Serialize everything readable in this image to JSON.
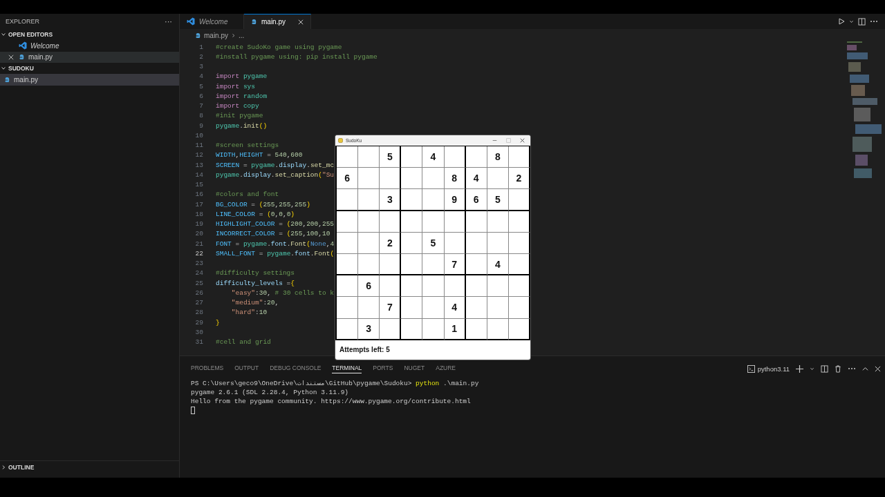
{
  "sidebar": {
    "title": "EXPLORER",
    "more": "···",
    "sections": [
      {
        "title": "OPEN EDITORS",
        "expanded": true,
        "items": [
          {
            "label": "Welcome",
            "kind": "welcome",
            "preview": true,
            "selected": false
          },
          {
            "label": "main.py",
            "kind": "python",
            "preview": false,
            "selected": true
          }
        ]
      },
      {
        "title": "SUDOKU",
        "expanded": true,
        "items": [
          {
            "label": "main.py",
            "kind": "python",
            "preview": false,
            "selected": true
          }
        ]
      },
      {
        "title": "OUTLINE",
        "expanded": false
      }
    ]
  },
  "tabs": [
    {
      "label": "Welcome",
      "kind": "welcome",
      "preview": true,
      "selected": false
    },
    {
      "label": "main.py",
      "kind": "python",
      "preview": false,
      "selected": true
    }
  ],
  "breadcrumb": [
    "main.py",
    "..."
  ],
  "code_lines": [
    {
      "number": "1",
      "active": false,
      "tokens": [
        {
          "kind": "comment",
          "text": "#create SudoKo game using pygame"
        }
      ]
    },
    {
      "number": "2",
      "active": false,
      "tokens": [
        {
          "kind": "comment",
          "text": "#install pygame using: pip install pygame"
        }
      ]
    },
    {
      "number": "3",
      "active": false
    },
    {
      "number": "4",
      "active": false,
      "tokens": [
        {
          "kind": "keyword",
          "text": "import "
        },
        {
          "kind": "module",
          "text": "pygame"
        }
      ]
    },
    {
      "number": "5",
      "active": false,
      "tokens": [
        {
          "kind": "keyword",
          "text": "import "
        },
        {
          "kind": "module",
          "text": "sys"
        }
      ]
    },
    {
      "number": "6",
      "active": false,
      "tokens": [
        {
          "kind": "keyword",
          "text": "import "
        },
        {
          "kind": "module",
          "text": "random"
        }
      ]
    },
    {
      "number": "7",
      "active": false,
      "tokens": [
        {
          "kind": "keyword",
          "text": "import "
        },
        {
          "kind": "module",
          "text": "copy"
        }
      ]
    },
    {
      "number": "8",
      "active": false,
      "tokens": [
        {
          "kind": "comment",
          "text": "#init pygame"
        }
      ]
    },
    {
      "number": "9",
      "active": false,
      "tokens": [
        {
          "kind": "module",
          "text": "pygame"
        },
        {
          "kind": "plain",
          "text": "."
        },
        {
          "kind": "function",
          "text": "init"
        },
        {
          "kind": "bracket",
          "text": "()"
        }
      ]
    },
    {
      "number": "10",
      "active": false
    },
    {
      "number": "11",
      "active": false,
      "tokens": [
        {
          "kind": "comment",
          "text": "#screen settings"
        }
      ]
    },
    {
      "number": "12",
      "active": false,
      "tokens": [
        {
          "kind": "constant",
          "text": "WIDTH"
        },
        {
          "kind": "plain",
          "text": ","
        },
        {
          "kind": "constant",
          "text": "HEIGHT"
        },
        {
          "kind": "plain",
          "text": " = "
        },
        {
          "kind": "number",
          "text": "540"
        },
        {
          "kind": "plain",
          "text": ","
        },
        {
          "kind": "number",
          "text": "600"
        }
      ]
    },
    {
      "number": "13",
      "active": false,
      "tokens": [
        {
          "kind": "constant",
          "text": "SCREEN"
        },
        {
          "kind": "plain",
          "text": " = "
        },
        {
          "kind": "module",
          "text": "pygame"
        },
        {
          "kind": "plain",
          "text": "."
        },
        {
          "kind": "variable",
          "text": "display"
        },
        {
          "kind": "plain",
          "text": "."
        },
        {
          "kind": "function",
          "text": "set_mc"
        }
      ]
    },
    {
      "number": "14",
      "active": false,
      "tokens": [
        {
          "kind": "module",
          "text": "pygame"
        },
        {
          "kind": "plain",
          "text": "."
        },
        {
          "kind": "variable",
          "text": "display"
        },
        {
          "kind": "plain",
          "text": "."
        },
        {
          "kind": "function",
          "text": "set_caption"
        },
        {
          "kind": "bracket",
          "text": "("
        },
        {
          "kind": "string",
          "text": "\"Su"
        }
      ]
    },
    {
      "number": "15",
      "active": false
    },
    {
      "number": "16",
      "active": false,
      "tokens": [
        {
          "kind": "comment",
          "text": "#colors and font"
        }
      ]
    },
    {
      "number": "17",
      "active": false,
      "tokens": [
        {
          "kind": "constant",
          "text": "BG_COLOR"
        },
        {
          "kind": "plain",
          "text": " = "
        },
        {
          "kind": "bracket",
          "text": "("
        },
        {
          "kind": "number",
          "text": "255"
        },
        {
          "kind": "plain",
          "text": ","
        },
        {
          "kind": "number",
          "text": "255"
        },
        {
          "kind": "plain",
          "text": ","
        },
        {
          "kind": "number",
          "text": "255"
        },
        {
          "kind": "bracket",
          "text": ")"
        }
      ]
    },
    {
      "number": "18",
      "active": false,
      "tokens": [
        {
          "kind": "constant",
          "text": "LINE_COLOR"
        },
        {
          "kind": "plain",
          "text": " = "
        },
        {
          "kind": "bracket",
          "text": "("
        },
        {
          "kind": "number",
          "text": "0"
        },
        {
          "kind": "plain",
          "text": ","
        },
        {
          "kind": "number",
          "text": "0"
        },
        {
          "kind": "plain",
          "text": ","
        },
        {
          "kind": "number",
          "text": "0"
        },
        {
          "kind": "bracket",
          "text": ")"
        }
      ]
    },
    {
      "number": "19",
      "active": false,
      "tokens": [
        {
          "kind": "constant",
          "text": "HIGHLIGHT_COLOR"
        },
        {
          "kind": "plain",
          "text": " = "
        },
        {
          "kind": "bracket",
          "text": "("
        },
        {
          "kind": "number",
          "text": "200"
        },
        {
          "kind": "plain",
          "text": ","
        },
        {
          "kind": "number",
          "text": "200"
        },
        {
          "kind": "plain",
          "text": ","
        },
        {
          "kind": "number",
          "text": "255"
        }
      ]
    },
    {
      "number": "20",
      "active": false,
      "tokens": [
        {
          "kind": "constant",
          "text": "INCORRECT_COLOR"
        },
        {
          "kind": "plain",
          "text": " = "
        },
        {
          "kind": "bracket",
          "text": "("
        },
        {
          "kind": "number",
          "text": "255"
        },
        {
          "kind": "plain",
          "text": ","
        },
        {
          "kind": "number",
          "text": "100"
        },
        {
          "kind": "plain",
          "text": ","
        },
        {
          "kind": "number",
          "text": "10"
        }
      ]
    },
    {
      "number": "21",
      "active": false,
      "tokens": [
        {
          "kind": "constant",
          "text": "FONT"
        },
        {
          "kind": "plain",
          "text": " = "
        },
        {
          "kind": "module",
          "text": "pygame"
        },
        {
          "kind": "plain",
          "text": "."
        },
        {
          "kind": "variable",
          "text": "font"
        },
        {
          "kind": "plain",
          "text": "."
        },
        {
          "kind": "function",
          "text": "Font"
        },
        {
          "kind": "bracket",
          "text": "("
        },
        {
          "kind": "builtin",
          "text": "None"
        },
        {
          "kind": "plain",
          "text": ","
        },
        {
          "kind": "number",
          "text": "4"
        }
      ]
    },
    {
      "number": "22",
      "active": true,
      "tokens": [
        {
          "kind": "constant",
          "text": "SMALL_FONT"
        },
        {
          "kind": "plain",
          "text": " = "
        },
        {
          "kind": "module",
          "text": "pygame"
        },
        {
          "kind": "plain",
          "text": "."
        },
        {
          "kind": "variable",
          "text": "font"
        },
        {
          "kind": "plain",
          "text": "."
        },
        {
          "kind": "function",
          "text": "Font"
        },
        {
          "kind": "bracket",
          "text": "("
        }
      ]
    },
    {
      "number": "23",
      "active": false
    },
    {
      "number": "24",
      "active": false,
      "tokens": [
        {
          "kind": "comment",
          "text": "#difficulty settings"
        }
      ]
    },
    {
      "number": "25",
      "active": false,
      "tokens": [
        {
          "kind": "variable",
          "text": "difficulty_levels"
        },
        {
          "kind": "plain",
          "text": " ="
        },
        {
          "kind": "bracket",
          "text": "{"
        }
      ]
    },
    {
      "number": "26",
      "active": false,
      "indent": true,
      "tokens": [
        {
          "kind": "string",
          "text": "\"easy\""
        },
        {
          "kind": "plain",
          "text": ":"
        },
        {
          "kind": "number",
          "text": "30"
        },
        {
          "kind": "plain",
          "text": ", "
        },
        {
          "kind": "comment",
          "text": "# 30 cells to k"
        }
      ]
    },
    {
      "number": "27",
      "active": false,
      "indent": true,
      "tokens": [
        {
          "kind": "string",
          "text": "\"medium\""
        },
        {
          "kind": "plain",
          "text": ":"
        },
        {
          "kind": "number",
          "text": "20"
        },
        {
          "kind": "plain",
          "text": ","
        }
      ]
    },
    {
      "number": "28",
      "active": false,
      "indent": true,
      "tokens": [
        {
          "kind": "string",
          "text": "\"hard\""
        },
        {
          "kind": "plain",
          "text": ":"
        },
        {
          "kind": "number",
          "text": "10"
        }
      ]
    },
    {
      "number": "29",
      "active": false,
      "tokens": [
        {
          "kind": "bracket",
          "text": "}"
        }
      ]
    },
    {
      "number": "30",
      "active": false
    },
    {
      "number": "31",
      "active": false,
      "tokens": [
        {
          "kind": "comment",
          "text": "#cell and grid"
        }
      ]
    }
  ],
  "panel": {
    "tabs": [
      {
        "label": "PROBLEMS",
        "selected": false
      },
      {
        "label": "OUTPUT",
        "selected": false
      },
      {
        "label": "DEBUG CONSOLE",
        "selected": false
      },
      {
        "label": "TERMINAL",
        "selected": true
      },
      {
        "label": "PORTS",
        "selected": false
      },
      {
        "label": "NUGET",
        "selected": false
      },
      {
        "label": "AZURE",
        "selected": false
      }
    ],
    "shell": "python3.11",
    "terminal_lines": [
      [
        {
          "kind": "text",
          "text": "PS C:\\Users\\geco9\\OneDrive\\مستندات\\GitHub\\pygame\\Sudoku> "
        },
        {
          "kind": "command",
          "text": "python"
        },
        {
          "kind": "text",
          "text": " .\\main.py"
        }
      ],
      [
        {
          "kind": "text",
          "text": "pygame 2.6.1 (SDL 2.28.4, Python 3.11.9)"
        }
      ],
      [
        {
          "kind": "text",
          "text": "Hello from the pygame community. https://www.pygame.org/contribute.html"
        }
      ]
    ]
  },
  "game_window": {
    "title": "SudoKu",
    "rows": [
      [
        null,
        null,
        "5",
        null,
        "4",
        null,
        null,
        "8",
        null
      ],
      [
        "6",
        null,
        null,
        null,
        null,
        "8",
        "4",
        null,
        "2"
      ],
      [
        null,
        null,
        "3",
        null,
        null,
        "9",
        "6",
        "5",
        null
      ],
      [
        null,
        null,
        null,
        null,
        null,
        null,
        null,
        null,
        null
      ],
      [
        null,
        null,
        "2",
        null,
        "5",
        null,
        null,
        null,
        null
      ],
      [
        null,
        null,
        null,
        null,
        null,
        "7",
        null,
        "4",
        null
      ],
      [
        null,
        "6",
        null,
        null,
        null,
        null,
        null,
        null,
        null
      ],
      [
        null,
        null,
        "7",
        null,
        null,
        "4",
        null,
        null,
        null
      ],
      [
        null,
        "3",
        null,
        null,
        null,
        "1",
        null,
        null,
        null
      ]
    ],
    "status": "Attempts left: 5"
  }
}
